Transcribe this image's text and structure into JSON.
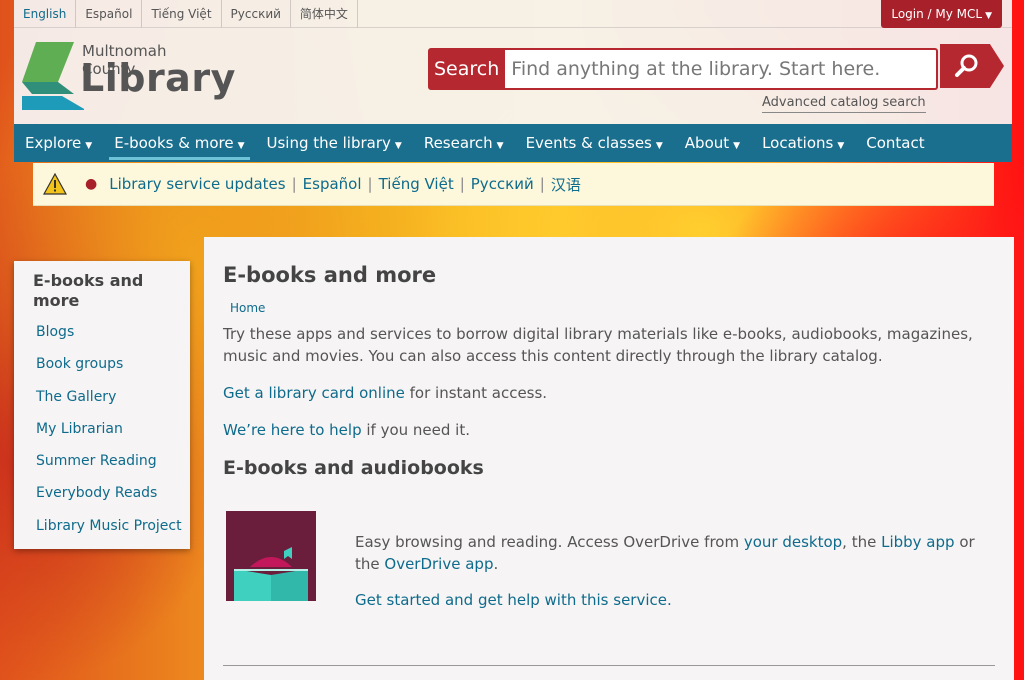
{
  "languages": [
    "English",
    "Español",
    "Tiếng Việt",
    "Русский",
    "简体中文"
  ],
  "login": {
    "label": "Login / My MCL"
  },
  "logo": {
    "county": "Multnomah County",
    "library": "Library"
  },
  "search": {
    "label": "Search",
    "placeholder": "Find anything at the library. Start here.",
    "advanced": "Advanced catalog search"
  },
  "nav": [
    {
      "label": "Explore"
    },
    {
      "label": "E-books & more"
    },
    {
      "label": "Using the library"
    },
    {
      "label": "Research"
    },
    {
      "label": "Events & classes"
    },
    {
      "label": "About"
    },
    {
      "label": "Locations"
    },
    {
      "label": "Contact"
    }
  ],
  "alert": {
    "links": [
      "Library service updates",
      "Español",
      "Tiếng Việt",
      "Русский",
      "汉语"
    ],
    "separator": "|"
  },
  "sidebar": {
    "title": "E-books and more",
    "items": [
      "Blogs",
      "Book groups",
      "The Gallery",
      "My Librarian",
      "Summer Reading",
      "Everybody Reads",
      "Library Music Project"
    ]
  },
  "content": {
    "title": "E-books and more",
    "breadcrumb": "Home",
    "intro": "Try these apps and services to borrow digital library materials like e-books, audiobooks, magazines, music and movies. You can also access this content directly through the library catalog.",
    "card_link": "Get a library card online",
    "card_text": " for instant access.",
    "help_link": "We’re here to help",
    "help_text": " if you need it.",
    "section_title": "E-books and audiobooks",
    "service": {
      "desc_1": "Easy browsing and reading. Access OverDrive from ",
      "link_desktop": "your desktop",
      "desc_2": ", the ",
      "link_libby": "Libby app",
      "desc_3": " or the ",
      "link_overdrive": "OverDrive app",
      "desc_4": ".",
      "get_started": "Get started and get help with this service."
    }
  },
  "colors": {
    "brand_red": "#b5282f",
    "nav_blue": "#1b6f8e",
    "link": "#0f6b8c"
  }
}
